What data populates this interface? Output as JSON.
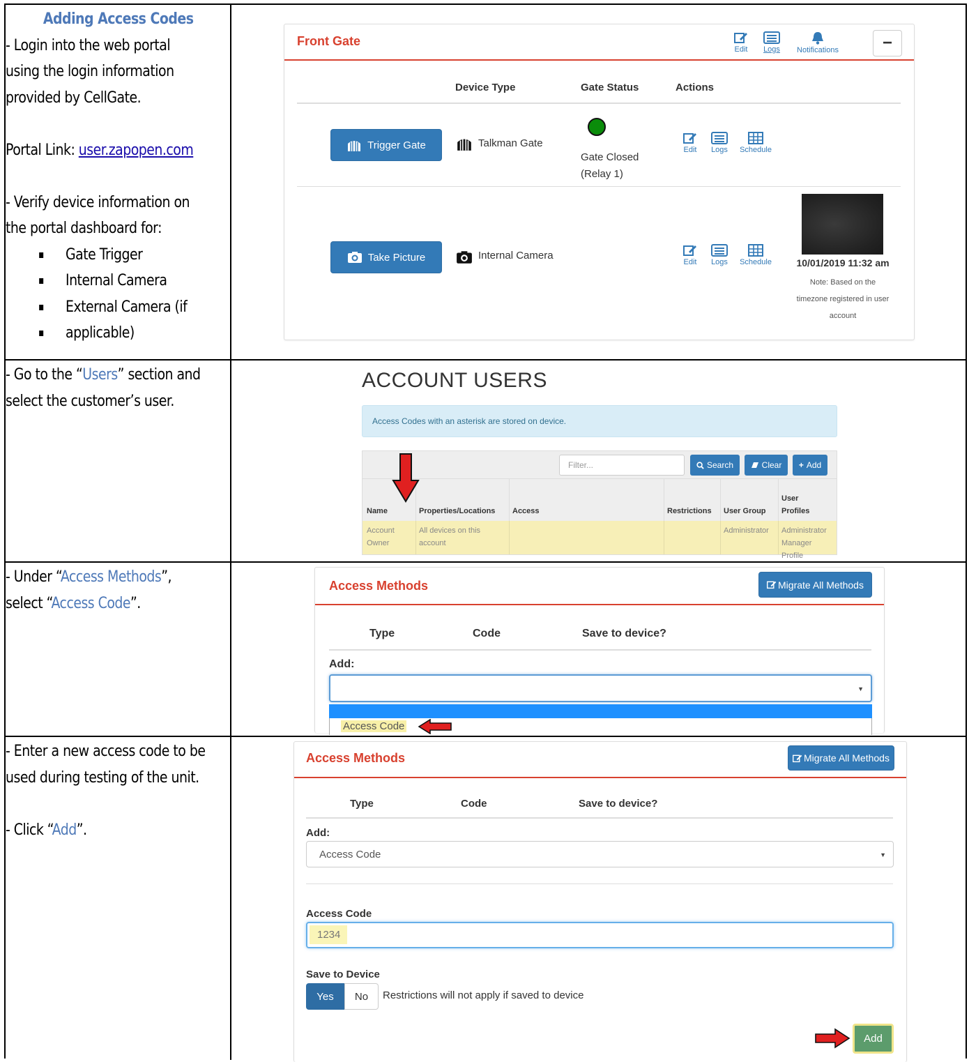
{
  "instructions": {
    "row1": {
      "title": "Adding Access Codes",
      "line1": "- Login into the web portal",
      "line2": "using the login information",
      "line3": "provided by CellGate.",
      "portal_label": "Portal Link: ",
      "portal_link": "user.zapopen.com",
      "verify_line1": "- Verify device information on",
      "verify_line2": "the portal dashboard for:",
      "bullets": [
        "Gate Trigger",
        "Internal Camera",
        "External Camera (if",
        "applicable)"
      ]
    },
    "row2": {
      "p1": "- Go to the “",
      "hl": "Users",
      "p2": "” section and",
      "line2": "select the customer’s user."
    },
    "row3": {
      "p1": "- Under “",
      "hl1": "Access Methods",
      "p2": "”,",
      "p3": "select “",
      "hl2": "Access Code",
      "p4": "”."
    },
    "row4": {
      "line1": "- Enter a new access code to be",
      "line2": "used during testing of the unit.",
      "p1": "- Click “",
      "hl": "Add",
      "p2": "”."
    }
  },
  "front_gate": {
    "title": "Front Gate",
    "header_actions": [
      "Edit",
      "Logs",
      "Notifications"
    ],
    "collapse_symbol": "−",
    "columns": [
      "Device Type",
      "Gate Status",
      "Actions"
    ],
    "rows": [
      {
        "button": "Trigger Gate",
        "device": "Talkman Gate",
        "status_line1": "Gate Closed",
        "status_line2": "(Relay 1)",
        "status_color": "#0a8c0a",
        "actions": [
          "Edit",
          "Logs",
          "Schedule"
        ]
      },
      {
        "button": "Take Picture",
        "device": "Internal Camera",
        "actions": [
          "Edit",
          "Logs",
          "Schedule"
        ],
        "timestamp": "10/01/2019 11:32 am",
        "note_line1": "Note: Based on the",
        "note_line2": "timezone registered in user",
        "note_line3": "account"
      }
    ]
  },
  "account_users": {
    "title": "ACCOUNT USERS",
    "alert": "Access Codes with an asterisk are stored on device.",
    "filter_placeholder": "Filter...",
    "buttons": [
      "Search",
      "Clear",
      "Add"
    ],
    "columns": [
      "Name",
      "Properties/Locations",
      "Access",
      "Restrictions",
      "User Group",
      "User",
      "Profiles"
    ],
    "row": {
      "name1": "Account",
      "name2": "Owner",
      "prop1": "All devices on this",
      "prop2": "account",
      "group": "Administrator",
      "profile1": "Administrator",
      "profile2": "Manager",
      "profile3": "Profile"
    }
  },
  "access_methods_1": {
    "title": "Access Methods",
    "migrate": "Migrate All Methods",
    "columns": [
      "Type",
      "Code",
      "Save to device?"
    ],
    "add_label": "Add:",
    "option": "Access Code"
  },
  "access_methods_2": {
    "title": "Access Methods",
    "migrate": "Migrate All Methods",
    "columns": [
      "Type",
      "Code",
      "Save to device?"
    ],
    "add_label": "Add:",
    "selected": "Access Code",
    "code_label": "Access Code",
    "code_value": "1234",
    "save_label": "Save to Device",
    "yes": "Yes",
    "no": "No",
    "note": "Restrictions will not apply if saved to device",
    "add_button": "Add"
  }
}
